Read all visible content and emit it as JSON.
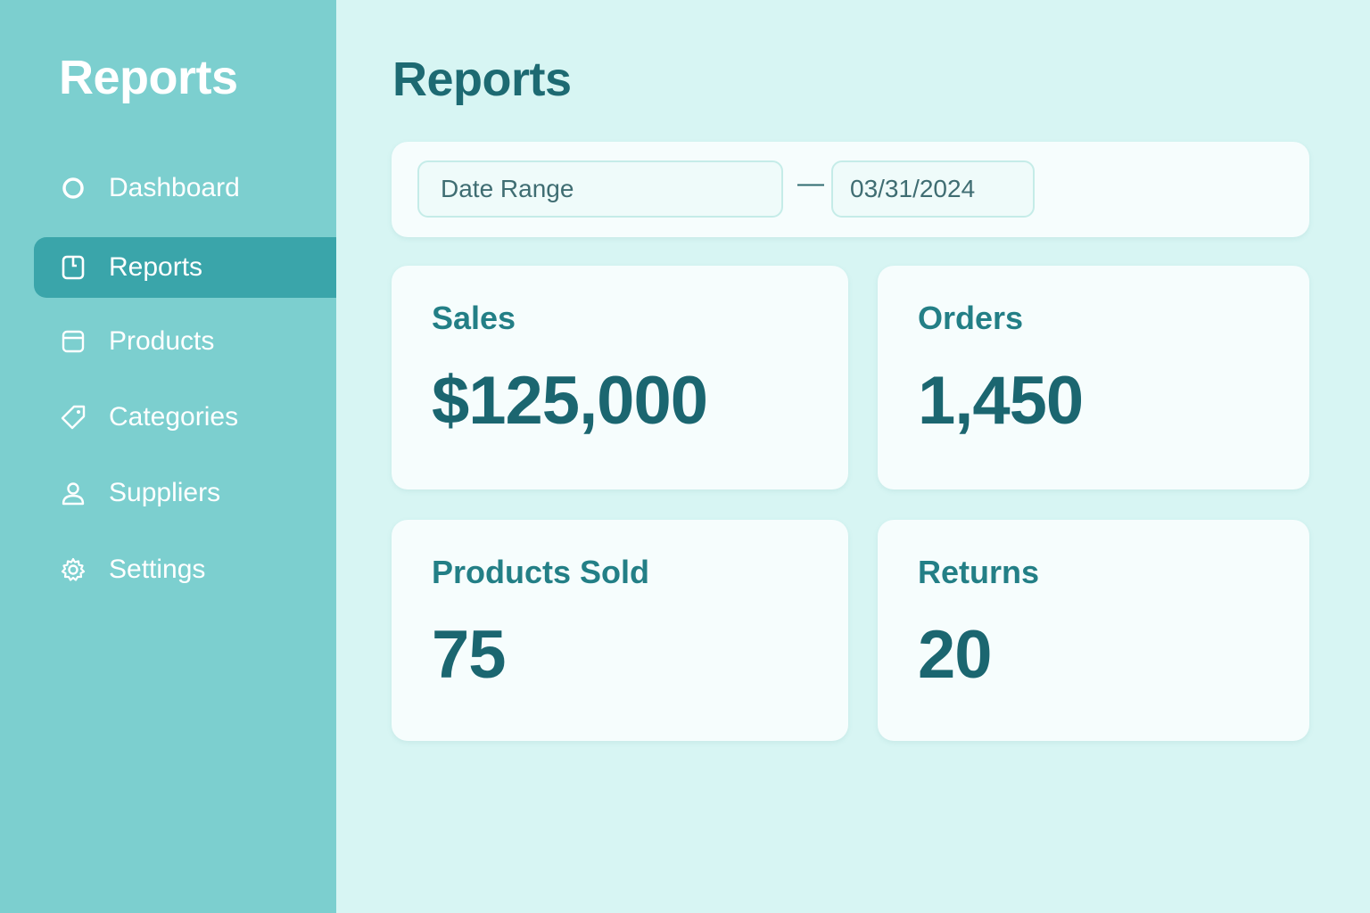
{
  "sidebar": {
    "title": "Reports",
    "items": [
      {
        "label": "Dashboard",
        "icon": "circle-icon",
        "active": false
      },
      {
        "label": "Reports",
        "icon": "report-icon",
        "active": true
      },
      {
        "label": "Products",
        "icon": "box-icon",
        "active": false
      },
      {
        "label": "Categories",
        "icon": "tag-icon",
        "active": false
      },
      {
        "label": "Suppliers",
        "icon": "user-icon",
        "active": false
      },
      {
        "label": "Settings",
        "icon": "gear-icon",
        "active": false
      }
    ]
  },
  "main": {
    "title": "Reports",
    "filter": {
      "date_range_placeholder": "Date Range",
      "separator": "—",
      "end_date": "03/31/2024"
    },
    "stats": [
      {
        "label": "Sales",
        "value": "$125,000"
      },
      {
        "label": "Orders",
        "value": "1,450"
      },
      {
        "label": "Products Sold",
        "value": "75"
      },
      {
        "label": "Returns",
        "value": "20"
      }
    ]
  },
  "colors": {
    "sidebar_bg": "#7ccfcf",
    "active_item_bg": "#3aa5aa",
    "main_bg": "#d7f5f3",
    "card_bg": "#f6fdfd",
    "heading_text": "#1d6a72",
    "label_text": "#237f86"
  }
}
